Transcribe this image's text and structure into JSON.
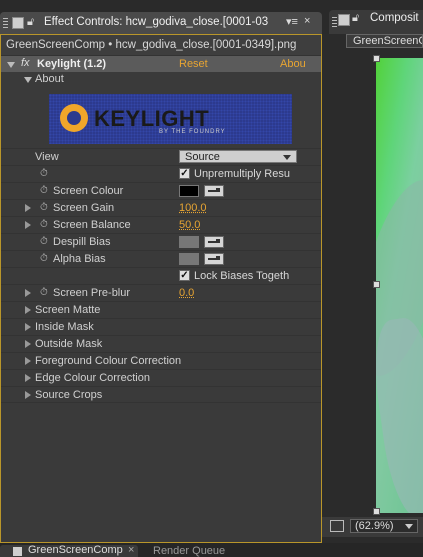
{
  "tabs": {
    "effect_controls_title": "Effect Controls: hcw_godiva_close.[0001-03",
    "composition_title": "Composit"
  },
  "ec": {
    "header": "GreenScreenComp • hcw_godiva_close.[0001-0349].png",
    "effect_name": "Keylight (1.2)",
    "reset": "Reset",
    "about_link": "Abou",
    "about": "About",
    "logo_text": "KEYLIGHT",
    "logo_sub": "BY THE FOUNDRY",
    "view_label": "View",
    "view_value": "Source",
    "unpremultiply": "Unpremultiply Resu",
    "screen_colour": "Screen Colour",
    "screen_colour_hex": "#000000",
    "screen_gain": "Screen Gain",
    "screen_gain_value": "100.0",
    "screen_balance": "Screen Balance",
    "screen_balance_value": "50.0",
    "despill_bias": "Despill Bias",
    "alpha_bias": "Alpha Bias",
    "lock_biases": "Lock Biases Togeth",
    "screen_preblur": "Screen Pre-blur",
    "screen_preblur_value": "0.0",
    "groups": [
      "Screen Matte",
      "Inside Mask",
      "Outside Mask",
      "Foreground Colour Correction",
      "Edge Colour Correction",
      "Source Crops"
    ]
  },
  "comp": {
    "crumb": "GreenScreenC",
    "zoom": "(62.9%)"
  },
  "bottom_tabs": [
    "GreenScreenComp",
    "Render Queue"
  ]
}
